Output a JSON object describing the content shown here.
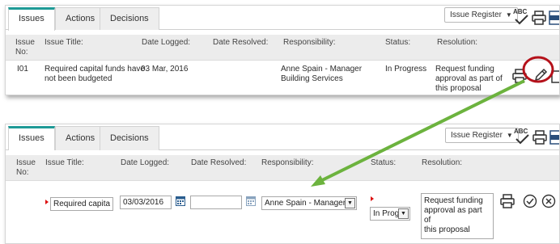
{
  "tabs": [
    "Issues",
    "Actions",
    "Decisions"
  ],
  "register_select": {
    "label": "Issue Register"
  },
  "toolbar_icons": {
    "spellcheck": "ABC",
    "spellcheck_icon": "spellcheck-icon",
    "print_icon": "print-icon",
    "export_icon": "excel-export-icon"
  },
  "columns": {
    "issue_no": [
      "Issue",
      "No:"
    ],
    "title": "Issue Title:",
    "logged": "Date Logged:",
    "resolved": "Date Resolved:",
    "responsibility": "Responsibility:",
    "status": "Status:",
    "resolution": "Resolution:"
  },
  "view_row": {
    "issue_no": "I01",
    "title_lines": [
      "Required capital funds have",
      "not been budgeted"
    ],
    "logged": "03 Mar, 2016",
    "resolved": "",
    "responsibility_lines": [
      "Anne Spain - Manager",
      "Building Services"
    ],
    "status": "In Progress",
    "resolution_lines": [
      "Request funding",
      "approval as part of",
      "this proposal"
    ]
  },
  "edit_row": {
    "title_value": "Required capital f",
    "logged_value": "03/03/2016",
    "resolved_value": "",
    "responsibility_value": "Anne Spain - Manager E",
    "status_value": "In Prog",
    "resolution_lines": [
      "Request funding",
      "approval as part of",
      "this proposal"
    ]
  },
  "colors": {
    "accent_tab": "#1e9a96",
    "arrow": "#6cb33e",
    "highlight_circle": "#b5121b",
    "required": "#dd1111"
  }
}
